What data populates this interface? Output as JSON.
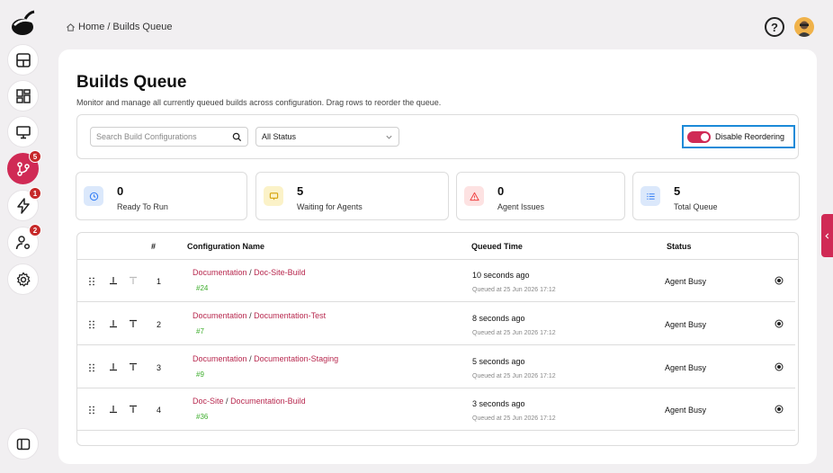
{
  "sidebar": {
    "items": [
      {
        "icon": "layout-grid-icon"
      },
      {
        "icon": "dashboard-icon"
      },
      {
        "icon": "monitor-icon"
      },
      {
        "icon": "branch-icon",
        "badge": "5",
        "active": true
      },
      {
        "icon": "lightning-icon",
        "badge": "1"
      },
      {
        "icon": "user-settings-icon",
        "badge": "2"
      },
      {
        "icon": "gear-icon"
      }
    ]
  },
  "breadcrumb": {
    "home": "Home",
    "separator": "/",
    "current": "Builds Queue"
  },
  "header": {
    "help": "?"
  },
  "page": {
    "title": "Builds Queue",
    "subtitle": "Monitor and manage all currently queued builds across configuration. Drag rows to reorder the queue."
  },
  "filters": {
    "search_placeholder": "Search Build Configurations",
    "status_value": "All Status",
    "reorder_label": "Disable Reordering"
  },
  "stats": [
    {
      "value": "0",
      "label": "Ready To Run",
      "icon": "clock-icon",
      "color": "#3b82f6"
    },
    {
      "value": "5",
      "label": "Waiting for Agents",
      "icon": "monitor-icon",
      "color": "#eab308"
    },
    {
      "value": "0",
      "label": "Agent Issues",
      "icon": "warning-icon",
      "color": "#ef4444"
    },
    {
      "value": "5",
      "label": "Total Queue",
      "icon": "list-icon",
      "color": "#3b82f6"
    }
  ],
  "table": {
    "headers": {
      "num": "#",
      "config": "Configuration Name",
      "queued": "Queued Time",
      "status": "Status"
    },
    "rows": [
      {
        "num": "1",
        "project": "Documentation",
        "sep": "/",
        "config": "Doc-Site-Build",
        "build": "#24",
        "queued": "10 seconds ago",
        "queued_at": "Queued at 25 Jun 2026 17:12",
        "status": "Agent Busy"
      },
      {
        "num": "2",
        "project": "Documentation",
        "sep": "/",
        "config": "Documentation-Test",
        "build": "#7",
        "queued": "8 seconds ago",
        "queued_at": "Queued at 25 Jun 2026 17:12",
        "status": "Agent Busy"
      },
      {
        "num": "3",
        "project": "Documentation",
        "sep": "/",
        "config": "Documentation-Staging",
        "build": "#9",
        "queued": "5 seconds ago",
        "queued_at": "Queued at 25 Jun 2026 17:12",
        "status": "Agent Busy"
      },
      {
        "num": "4",
        "project": "Doc-Site",
        "sep": "/",
        "config": "Documentation-Build",
        "build": "#36",
        "queued": "3 seconds ago",
        "queued_at": "Queued at 25 Jun 2026 17:12",
        "status": "Agent Busy"
      }
    ]
  },
  "colors": {
    "accent": "#d02a55",
    "link": "#b8294f",
    "build": "#3fae2e",
    "focus": "#1b8ad8"
  }
}
